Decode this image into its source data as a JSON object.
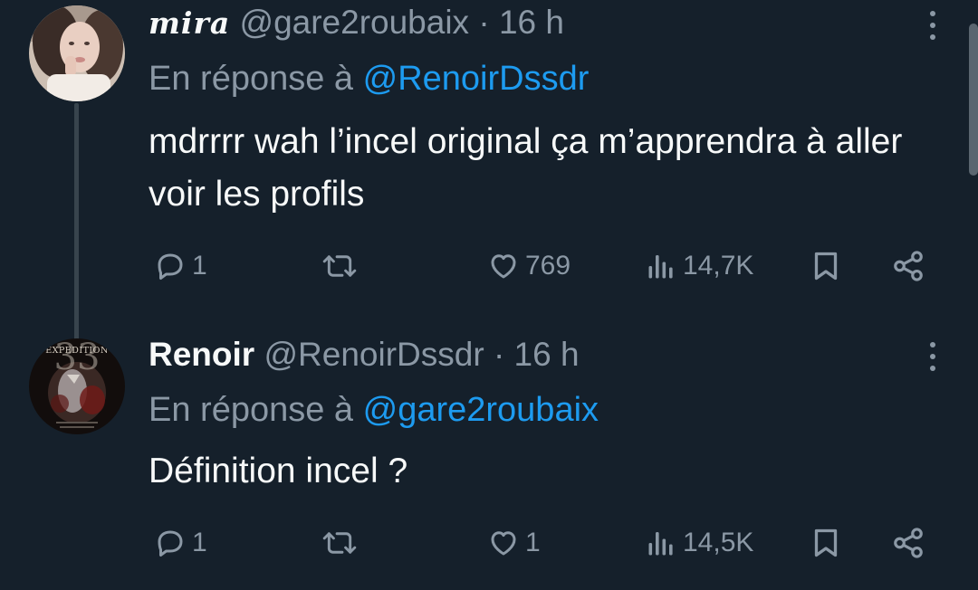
{
  "tweets": [
    {
      "display_name": "mira",
      "handle": "@gare2roubaix",
      "separator": "·",
      "time": "16 h",
      "reply_prefix": "En réponse à",
      "reply_to": "@RenoirDssdr",
      "text": "mdrrrr wah l’incel original ça m’apprendra à aller voir les profils",
      "replies": "1",
      "retweets": "",
      "likes": "769",
      "views": "14,7K"
    },
    {
      "display_name": "Renoir",
      "handle": "@RenoirDssdr",
      "separator": "·",
      "time": "16 h",
      "reply_prefix": "En réponse à",
      "reply_to": "@gare2roubaix",
      "text": "Définition incel ?",
      "replies": "1",
      "retweets": "",
      "likes": "1",
      "views": "14,5K",
      "avatar_text": "EXPEDITION"
    }
  ],
  "colors": {
    "background": "#15202b",
    "text": "#f7f9f9",
    "muted": "#8b98a5",
    "link": "#1d9bf0"
  },
  "icons": {
    "reply": "reply-icon",
    "retweet": "retweet-icon",
    "like": "heart-icon",
    "views": "views-icon",
    "bookmark": "bookmark-icon",
    "share": "share-icon",
    "more": "more-icon"
  }
}
